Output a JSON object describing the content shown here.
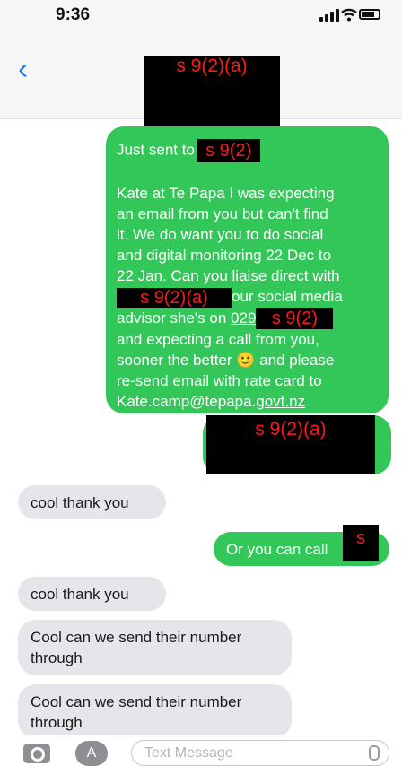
{
  "status_bar": {
    "time": "9:36"
  },
  "header": {
    "back_glyph": "‹",
    "contact_redaction": "s 9(2)(a)"
  },
  "messages": [
    {
      "direction": "sent",
      "lines": [
        {
          "parts": [
            {
              "text": "Just sent to "
            },
            {
              "redaction": "s 9(2)"
            }
          ]
        },
        {
          "parts": []
        },
        {
          "parts": [
            {
              "text": "Kate at Te Papa I was expecting"
            }
          ]
        },
        {
          "parts": [
            {
              "text": "an email from you but can't find"
            }
          ]
        },
        {
          "parts": [
            {
              "text": "it. We do want you to do social"
            }
          ]
        },
        {
          "parts": [
            {
              "text": "and digital monitoring 22 Dec to"
            }
          ]
        },
        {
          "parts": [
            {
              "text": "22 Jan. Can you liaise direct with"
            }
          ]
        },
        {
          "parts": [
            {
              "redaction": "s 9(2)(a)"
            },
            {
              "text": "our social media"
            }
          ]
        },
        {
          "parts": [
            {
              "text": "advisor she's on "
            },
            {
              "text": "029",
              "underline": true
            },
            {
              "redaction": "s 9(2)"
            }
          ]
        },
        {
          "parts": [
            {
              "text": "and expecting a call from you,"
            }
          ]
        },
        {
          "parts": [
            {
              "text": "sooner the better 🙂 and please"
            }
          ]
        },
        {
          "parts": [
            {
              "text": "re-send email with rate card to"
            }
          ]
        },
        {
          "parts": [
            {
              "text": "Kate.camp@tepapa."
            },
            {
              "text": "govt.nz",
              "underline": true
            }
          ]
        }
      ]
    },
    {
      "direction": "sent",
      "redaction": "s 9(2)(a)"
    },
    {
      "direction": "received",
      "text": "cool thank you"
    },
    {
      "direction": "sent",
      "text": "Or you can call",
      "redaction": "s"
    },
    {
      "direction": "received",
      "text": "cool thank you"
    },
    {
      "direction": "received",
      "text": "Cool can we send their number through"
    },
    {
      "direction": "received",
      "text": "Cool can we send their number through"
    }
  ],
  "input_bar": {
    "placeholder": "Text Message",
    "camera_icon": "camera-icon",
    "apps_icon": "app-store-icon",
    "mic_icon": "microphone-icon"
  },
  "colors": {
    "sent_bubble": "#33c759",
    "received_bubble": "#e6e6ea",
    "accent": "#1f7cf0",
    "redaction_bg": "#000000",
    "redaction_text": "#ff1a1a"
  }
}
